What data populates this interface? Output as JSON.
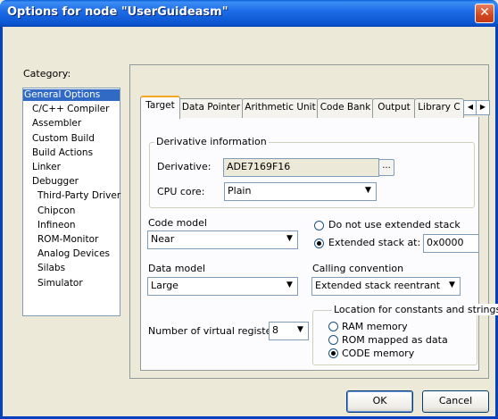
{
  "window": {
    "title": "Options for node \"UserGuideasm\"",
    "close_glyph": "✕"
  },
  "category": {
    "label": "Category:",
    "items": [
      {
        "label": "General Options",
        "selected": true,
        "indent": 0
      },
      {
        "label": "C/C++ Compiler",
        "indent": 1
      },
      {
        "label": "Assembler",
        "indent": 1
      },
      {
        "label": "Custom Build",
        "indent": 1
      },
      {
        "label": "Build Actions",
        "indent": 1
      },
      {
        "label": "Linker",
        "indent": 1
      },
      {
        "label": "Debugger",
        "indent": 1
      },
      {
        "label": "Third-Party Driver",
        "indent": 2
      },
      {
        "label": "Chipcon",
        "indent": 2
      },
      {
        "label": "Infineon",
        "indent": 2
      },
      {
        "label": "ROM-Monitor",
        "indent": 2
      },
      {
        "label": "Analog Devices",
        "indent": 2
      },
      {
        "label": "Silabs",
        "indent": 2
      },
      {
        "label": "Simulator",
        "indent": 2
      }
    ]
  },
  "tabs": [
    "Target",
    "Data Pointer",
    "Arithmetic Unit",
    "Code Bank",
    "Output",
    "Library C"
  ],
  "active_tab": "Target",
  "tab_scroll": {
    "left": "◀",
    "right": "▶"
  },
  "derivative_info": {
    "legend": "Derivative information",
    "derivative_label": "Derivative:",
    "derivative_value": "ADE7169F16",
    "browse": "...",
    "cpu_core_label": "CPU core:",
    "cpu_core_value": "Plain"
  },
  "code_model": {
    "label": "Code model",
    "value": "Near"
  },
  "data_model": {
    "label": "Data model",
    "value": "Large"
  },
  "stack": {
    "no_ext_label": "Do not use extended stack",
    "ext_label": "Extended stack at:",
    "ext_value": "0x0000",
    "selected": "extended"
  },
  "calling_convention": {
    "label": "Calling convention",
    "value": "Extended stack reentrant"
  },
  "virtual_registers": {
    "label": "Number of virtual registers:",
    "value": "8"
  },
  "location": {
    "legend": "Location for constants and strings",
    "options": [
      "RAM memory",
      "ROM mapped as data",
      "CODE memory"
    ],
    "selected": 2
  },
  "buttons": {
    "ok": "OK",
    "cancel": "Cancel"
  },
  "icons": {
    "dropdown": "▼"
  }
}
